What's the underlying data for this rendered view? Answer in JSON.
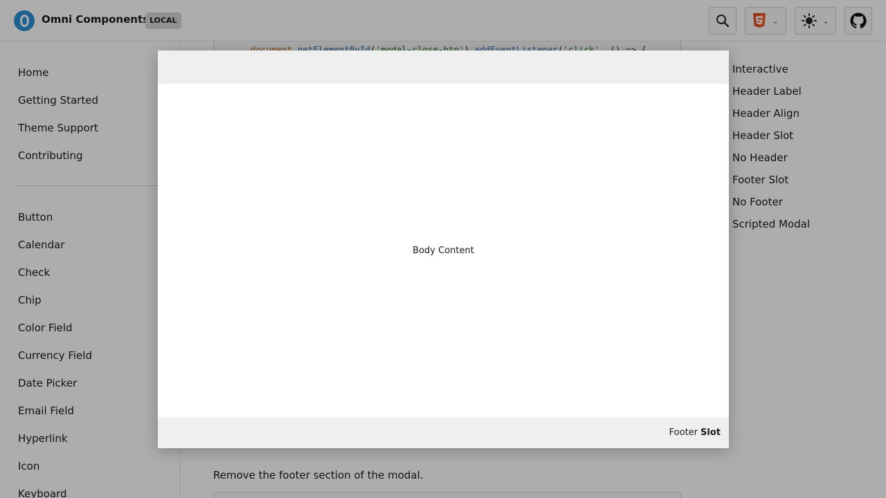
{
  "header": {
    "app_title": "Omni Components",
    "env_badge": "LOCAL",
    "buttons": {
      "search_icon": "search-icon",
      "framework_icon": "html5-icon",
      "theme_icon": "sun-icon",
      "github_icon": "github-icon"
    }
  },
  "sidebar": {
    "primary": [
      "Home",
      "Getting Started",
      "Theme Support",
      "Contributing"
    ],
    "components": [
      "Button",
      "Calendar",
      "Check",
      "Chip",
      "Color Field",
      "Currency Field",
      "Date Picker",
      "Email Field",
      "Hyperlink",
      "Icon",
      "Keyboard"
    ]
  },
  "main": {
    "code_line": {
      "obj": "document",
      "fn1": "getElementById",
      "arg": "'modal-close-btn'",
      "fn2": "addEventListener",
      "event": "'click'",
      "rest": ", () => {"
    },
    "section_description": "Remove the footer section of the modal."
  },
  "toc": [
    "Interactive",
    "Header Label",
    "Header Align",
    "Header Slot",
    "No Header",
    "Footer Slot",
    "No Footer",
    "Scripted Modal"
  ],
  "modal": {
    "body_text": "Body Content",
    "footer_text": "Footer",
    "footer_bold": "Slot"
  },
  "colors": {
    "brand": "#2b8fd6",
    "overlay": "rgba(0,0,0,0.32)",
    "modal_header_bg": "#efefef",
    "html5_orange": "#e44d26"
  }
}
